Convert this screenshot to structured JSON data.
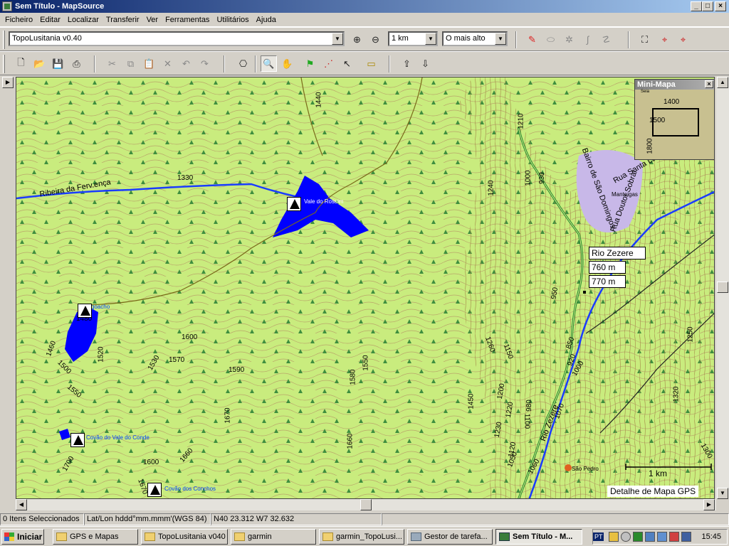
{
  "window": {
    "title": "Sem Título - MapSource"
  },
  "menu": [
    "Ficheiro",
    "Editar",
    "Localizar",
    "Transferir",
    "Ver",
    "Ferramentas",
    "Utilitários",
    "Ajuda"
  ],
  "toolbar": {
    "product": "TopoLusitania v0.40",
    "zoom_scale": "1 km",
    "detail": "O mais alto"
  },
  "map": {
    "place_labels": [
      "Ribeira da Ferv.ença",
      "Vale do Rossim",
      "Lagoacho",
      "Covão do Vale do Conde",
      "Covão dos Conchos",
      "Rua Santa Luzia",
      "Bairro de São Domingos",
      "Rio Zezere",
      "São Pedro",
      "Manteigas",
      "Rua Doutor Sobral"
    ],
    "contour_labels": [
      "1440",
      "1330",
      "1240",
      "1210",
      "1000",
      "930",
      "1450",
      "1460",
      "1480",
      "1520",
      "1500",
      "1550",
      "1530",
      "1570",
      "1600",
      "1590",
      "1580",
      "1550",
      "1670",
      "1660",
      "1600",
      "1660",
      "1700",
      "1670",
      "1260",
      "1150",
      "1200",
      "1220",
      "1230",
      "1100",
      "1120",
      "1050",
      "1060",
      "980",
      "950",
      "850",
      "920",
      "1000",
      "1070",
      "1250",
      "1320",
      "1300",
      "1450"
    ],
    "tooltip": [
      "Rio Zezere",
      "760 m",
      "770 m"
    ],
    "scale_label": "1 km",
    "detail_label": "Detalhe de Mapa GPS"
  },
  "minimap": {
    "title": "Mini-Mapa",
    "labels": [
      "1400",
      "1500",
      "1800",
      "Seia"
    ]
  },
  "status": {
    "selected": "0 Itens Seleccionados",
    "format": "Lat/Lon hddd°mm.mmm'(WGS 84)",
    "coords": "N40 23.312 W7 32.632"
  },
  "taskbar": {
    "start": "Iniciar",
    "tasks": [
      "GPS e Mapas",
      "TopoLusitania v040",
      "garmin",
      "garmin_TopoLusi...",
      "Gestor de tarefa...",
      "Sem Título - M..."
    ],
    "lang": "PT",
    "clock": "15:45"
  }
}
